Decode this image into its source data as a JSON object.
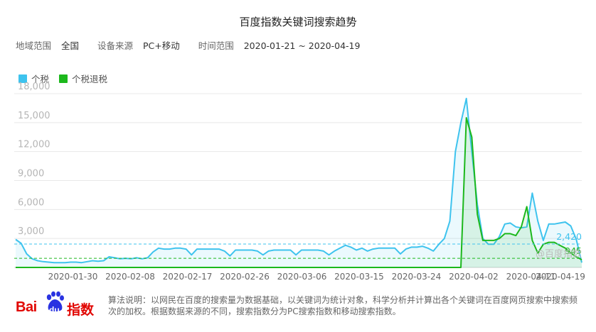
{
  "title": "百度指数关键词搜索趋势",
  "meta": {
    "region_label": "地域范围",
    "region_value": "全国",
    "source_label": "设备来源",
    "source_value": "PC+移动",
    "time_label": "时间范围",
    "time_value": "2020-01-21 ~ 2020-04-19"
  },
  "colors": {
    "series1": "#3ec3ee",
    "series2": "#1cb81c",
    "grid": "#e8e8e8",
    "brand": "#e10602"
  },
  "watermark": "@百度指数",
  "footer": {
    "logo_bai": "Bai",
    "logo_du": "du",
    "logo_zhishu": "指数",
    "note": "算法说明：以网民在百度的搜索量为数据基础，以关键词为统计对象，科学分析并计算出各个关键词在百度网页搜索中搜索频次的加权。根据数据来源的不同，搜索指数分为PC搜索指数和移动搜索指数。"
  },
  "chart_data": {
    "type": "line",
    "title": "百度指数关键词搜索趋势",
    "ylim": [
      0,
      18000
    ],
    "yticks": [
      "3,000",
      "6,000",
      "9,000",
      "12,000",
      "15,000",
      "18,000"
    ],
    "ytick_values": [
      3000,
      6000,
      9000,
      12000,
      15000,
      18000
    ],
    "xticks": [
      "2020-01-30",
      "2020-02-08",
      "2020-02-17",
      "2020-02-26",
      "2020-03-06",
      "2020-03-15",
      "2020-03-24",
      "2020-04-02",
      "2020-04-11",
      "2020-04-19"
    ],
    "x_start": "2020-01-21",
    "x_end": "2020-04-19",
    "grid": true,
    "legend_position": "top-left",
    "series": [
      {
        "name": "个税",
        "average": 2420,
        "average_label": "2,420",
        "values": [
          2900,
          2500,
          1400,
          900,
          700,
          600,
          550,
          500,
          500,
          500,
          550,
          550,
          500,
          600,
          700,
          650,
          700,
          1100,
          1000,
          900,
          950,
          900,
          1000,
          900,
          1000,
          1600,
          2000,
          1900,
          1900,
          2000,
          2000,
          1900,
          1300,
          1900,
          1900,
          1900,
          1900,
          1900,
          1700,
          1200,
          1800,
          1800,
          1800,
          1800,
          1700,
          1300,
          1700,
          1800,
          1800,
          1800,
          1800,
          1300,
          1800,
          1800,
          1800,
          1800,
          1700,
          1300,
          1700,
          2000,
          2300,
          2100,
          1800,
          2000,
          1700,
          1900,
          2000,
          2000,
          2000,
          2000,
          1400,
          1900,
          2100,
          2100,
          2200,
          2000,
          1700,
          2400,
          3000,
          4800,
          12000,
          15000,
          17500,
          12000,
          6500,
          3000,
          2400,
          2400,
          3200,
          4500,
          4600,
          4200,
          4100,
          4200,
          7700,
          4800,
          2800,
          4500,
          4500,
          4600,
          4700,
          4300,
          2900,
          500
        ]
      },
      {
        "name": "个税退税",
        "average": 945,
        "average_label": "945",
        "values": [
          0,
          0,
          0,
          0,
          0,
          0,
          0,
          0,
          0,
          0,
          0,
          0,
          0,
          0,
          0,
          0,
          0,
          0,
          0,
          0,
          0,
          0,
          0,
          0,
          0,
          0,
          0,
          0,
          0,
          0,
          0,
          0,
          0,
          0,
          0,
          0,
          0,
          0,
          0,
          0,
          0,
          0,
          0,
          0,
          0,
          0,
          0,
          0,
          0,
          0,
          0,
          0,
          0,
          0,
          0,
          0,
          0,
          0,
          0,
          0,
          0,
          0,
          0,
          0,
          0,
          0,
          0,
          0,
          0,
          0,
          0,
          0,
          0,
          0,
          0,
          0,
          0,
          0,
          0,
          0,
          0,
          0,
          15500,
          13500,
          5500,
          2800,
          2800,
          2800,
          3000,
          3500,
          3500,
          3300,
          4200,
          6300,
          2800,
          1500,
          2400,
          2600,
          2600,
          2300,
          2000,
          1500,
          1100,
          800
        ]
      }
    ]
  }
}
